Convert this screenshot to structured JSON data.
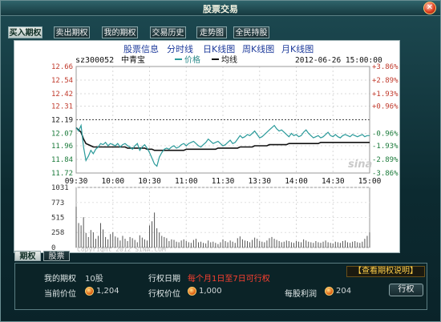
{
  "window": {
    "title": "股票交易"
  },
  "tabs": [
    {
      "label": "买入期权",
      "active": true
    },
    {
      "label": "卖出期权",
      "active": false
    },
    {
      "label": "我的期权",
      "active": false
    },
    {
      "label": "交易历史",
      "active": false
    },
    {
      "label": "走势图",
      "active": false
    },
    {
      "label": "全民持股",
      "active": false
    }
  ],
  "chart_nav": [
    "股票信息",
    "分时线",
    "日K线图",
    "周K线图",
    "月K线图"
  ],
  "subtabs": [
    {
      "label": "期权",
      "active": true
    },
    {
      "label": "股票",
      "active": false
    }
  ],
  "chart_data": {
    "type": "line",
    "stock_code": "sz300052",
    "stock_name": "中青宝",
    "datetime": "2012-06-26 15:00:00",
    "legend": [
      "价格",
      "均线"
    ],
    "price_ticks": [
      "12.66",
      "12.54",
      "12.42",
      "12.31",
      "12.19",
      "12.07",
      "11.96",
      "11.84",
      "11.72"
    ],
    "pct_ticks": [
      "+3.86%",
      "+2.89%",
      "+1.93%",
      "+0.96%",
      "",
      "-0.96%",
      "-1.93%",
      "-2.89%",
      "-3.86%"
    ],
    "prev_close": 12.19,
    "ylim": [
      11.72,
      12.66
    ],
    "x_ticks": [
      "09:30",
      "10:00",
      "10:30",
      "11:00",
      "11:30",
      "13:30",
      "14:00",
      "14:30",
      "15:00"
    ],
    "volume_ticks": [
      "1031",
      "773",
      "515",
      "258",
      "0"
    ],
    "price_x": [
      0,
      2,
      4,
      6,
      8,
      10,
      12,
      14,
      16,
      18,
      20,
      22,
      24,
      26,
      28,
      30,
      32,
      34,
      36,
      38,
      40,
      42,
      44,
      46,
      48,
      50,
      52,
      54,
      56,
      58,
      60,
      62,
      64,
      66,
      68,
      70,
      72,
      74,
      76,
      78,
      80,
      82,
      84,
      86,
      88,
      90,
      92,
      94,
      96,
      98,
      100,
      102,
      104,
      106,
      108,
      110,
      112,
      114,
      116,
      118,
      120,
      122,
      124,
      126,
      128,
      130,
      132,
      134,
      136,
      138,
      140,
      142,
      144,
      146,
      148,
      150,
      152,
      154,
      156,
      158,
      160,
      162,
      164,
      166,
      168,
      170,
      172,
      174,
      176,
      178,
      180,
      182,
      184,
      186,
      188,
      190,
      192,
      194,
      196,
      198,
      200,
      202,
      204,
      206,
      208,
      210,
      212,
      214,
      216,
      218,
      220,
      222,
      224,
      226,
      228,
      230,
      232,
      234,
      236,
      238,
      240
    ],
    "price": [
      12.12,
      12.09,
      12.14,
      11.95,
      11.83,
      11.87,
      11.92,
      11.89,
      11.93,
      11.95,
      11.98,
      11.97,
      11.99,
      11.96,
      11.98,
      11.97,
      11.96,
      11.98,
      11.95,
      11.97,
      11.98,
      11.96,
      11.95,
      11.93,
      11.96,
      11.98,
      11.92,
      11.95,
      11.97,
      11.94,
      11.9,
      11.85,
      11.8,
      11.78,
      11.86,
      11.9,
      11.93,
      11.94,
      11.93,
      11.95,
      11.96,
      11.94,
      11.95,
      11.97,
      11.98,
      11.96,
      11.98,
      11.99,
      12.0,
      11.98,
      11.96,
      11.95,
      11.97,
      11.99,
      12.02,
      12.0,
      11.98,
      11.99,
      12.0,
      11.98,
      11.96,
      11.97,
      11.99,
      12.01,
      11.98,
      11.99,
      12.02,
      12.05,
      12.03,
      12.04,
      12.06,
      12.05,
      12.07,
      12.09,
      12.06,
      12.03,
      12.04,
      12.06,
      12.08,
      12.1,
      12.12,
      12.14,
      12.11,
      12.09,
      12.1,
      12.08,
      12.06,
      12.04,
      12.07,
      12.05,
      12.06,
      12.04,
      12.05,
      12.08,
      12.1,
      12.07,
      12.05,
      12.03,
      12.04,
      12.05,
      12.03,
      12.04,
      12.06,
      12.08,
      12.05,
      12.04,
      12.06,
      12.04,
      12.03,
      12.05,
      12.06,
      12.05,
      12.04,
      12.06,
      12.05,
      12.04,
      12.05,
      12.06,
      12.04,
      12.05,
      12.05
    ],
    "avg": [
      12.12,
      12.1,
      12.08,
      12.02,
      11.98,
      11.97,
      11.96,
      11.95,
      11.95,
      11.95,
      11.95,
      11.95,
      11.95,
      11.95,
      11.95,
      11.95,
      11.95,
      11.95,
      11.95,
      11.95,
      11.95,
      11.94,
      11.94,
      11.94,
      11.94,
      11.94,
      11.94,
      11.94,
      11.94,
      11.93,
      11.93,
      11.93,
      11.92,
      11.92,
      11.92,
      11.92,
      11.92,
      11.92,
      11.92,
      11.92,
      11.92,
      11.92,
      11.92,
      11.92,
      11.92,
      11.93,
      11.93,
      11.93,
      11.93,
      11.93,
      11.93,
      11.93,
      11.93,
      11.93,
      11.93,
      11.93,
      11.93,
      11.93,
      11.94,
      11.94,
      11.94,
      11.94,
      11.94,
      11.94,
      11.94,
      11.94,
      11.94,
      11.95,
      11.95,
      11.95,
      11.95,
      11.95,
      11.95,
      11.96,
      11.96,
      11.96,
      11.96,
      11.96,
      11.96,
      11.97,
      11.97,
      11.97,
      11.97,
      11.97,
      11.97,
      11.97,
      11.97,
      11.98,
      11.98,
      11.98,
      11.98,
      11.98,
      11.98,
      11.98,
      11.98,
      11.98,
      11.98,
      11.98,
      11.98,
      11.98,
      11.99,
      11.99,
      11.99,
      11.99,
      11.99,
      11.99,
      11.99,
      11.99,
      11.99,
      11.99,
      11.99,
      11.99,
      11.99,
      11.99,
      11.99,
      11.99,
      11.99,
      11.99,
      11.99,
      11.99,
      11.99
    ],
    "volume": [
      700,
      420,
      380,
      520,
      250,
      180,
      300,
      260,
      150,
      200,
      420,
      310,
      180,
      140,
      230,
      260,
      190,
      170,
      120,
      200,
      150,
      110,
      180,
      160,
      130,
      90,
      210,
      170,
      140,
      120,
      380,
      450,
      600,
      330,
      260,
      200,
      180,
      160,
      110,
      140,
      130,
      100,
      90,
      120,
      140,
      110,
      90,
      80,
      130,
      150,
      90,
      100,
      80,
      70,
      120,
      90,
      100,
      80,
      60,
      90,
      140,
      110,
      90,
      120,
      100,
      80,
      160,
      190,
      140,
      120,
      110,
      90,
      130,
      170,
      150,
      110,
      100,
      90,
      120,
      160,
      180,
      150,
      130,
      110,
      90,
      100,
      120,
      110,
      90,
      80,
      110,
      100,
      90,
      140,
      120,
      100,
      90,
      80,
      110,
      90,
      80,
      100,
      120,
      90,
      80,
      70,
      100,
      90,
      80,
      110,
      120,
      90,
      80,
      100,
      110,
      90,
      80,
      100,
      150,
      200,
      260
    ],
    "vmax": 1031
  },
  "watermark": "sina",
  "copyright": "Copyright 2012 SINA.COM",
  "info": {
    "my_options_label": "我的期权",
    "my_options_value": "10股",
    "exercise_date_label": "行权日期",
    "exercise_date_value": "每个月1日至7日可行权",
    "help_button": "【查看期权说明】",
    "current_price_label": "当前价位",
    "current_price_value": "1,204",
    "exercise_price_label": "行权价位",
    "exercise_price_value": "1,000",
    "profit_label": "每股利润",
    "profit_value": "204",
    "exercise_button": "行权"
  }
}
